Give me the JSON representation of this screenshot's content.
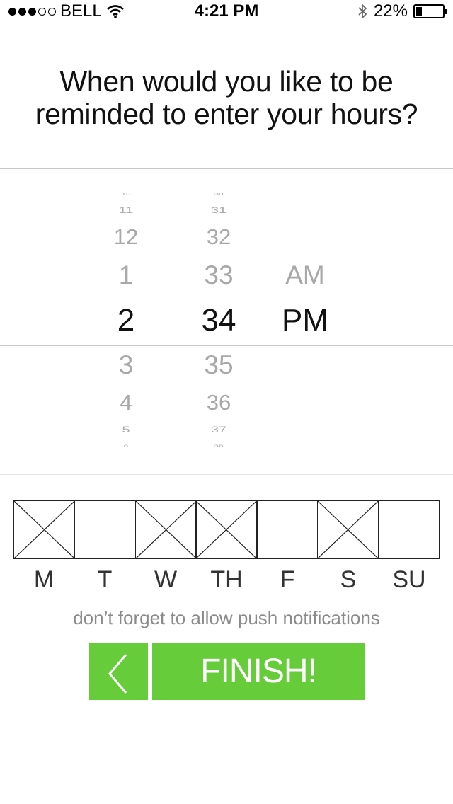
{
  "status_bar": {
    "signal_dots": [
      true,
      true,
      true,
      false,
      false
    ],
    "carrier": "BELL",
    "time": "4:21 PM",
    "battery_percent": "22%",
    "battery_level": 0.22,
    "icons": [
      "wifi-icon",
      "bluetooth-icon",
      "battery-icon"
    ]
  },
  "question": {
    "line1": "When would you like to be",
    "line2": "reminded to enter your hours?"
  },
  "picker": {
    "hours": [
      "10",
      "11",
      "12",
      "1",
      "2",
      "3",
      "4",
      "5",
      "6"
    ],
    "minutes": [
      "30",
      "31",
      "32",
      "33",
      "34",
      "35",
      "36",
      "37",
      "38"
    ],
    "selected_index": 4,
    "ampm": [
      "AM",
      "PM"
    ],
    "selected_ampm": "PM"
  },
  "days": [
    {
      "label": "M",
      "checked": true
    },
    {
      "label": "T",
      "checked": false
    },
    {
      "label": "W",
      "checked": true
    },
    {
      "label": "TH",
      "checked": true
    },
    {
      "label": "F",
      "checked": false
    },
    {
      "label": "S",
      "checked": true
    },
    {
      "label": "SU",
      "checked": false
    }
  ],
  "note": "don’t forget to allow push notifications",
  "buttons": {
    "back_icon": "chevron-left-icon",
    "finish_label": "FINISH!",
    "accent_color": "#66cc3a"
  }
}
